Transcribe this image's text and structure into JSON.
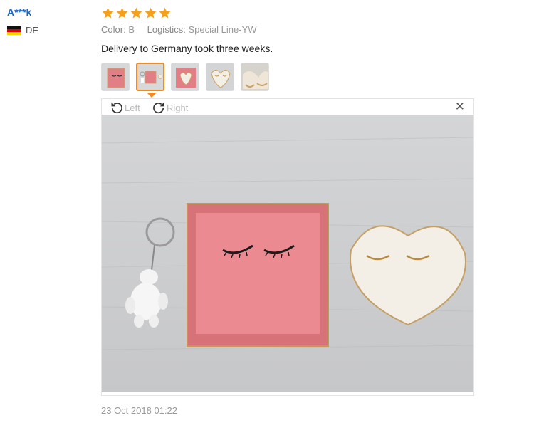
{
  "reviewer": {
    "name": "A***k",
    "country_code": "DE",
    "flag_icon": "germany-flag-icon"
  },
  "rating": {
    "stars": 5,
    "max": 5,
    "color": "#f5a01a"
  },
  "attributes": {
    "color_label": "Color:",
    "color_value": "B",
    "logistics_label": "Logistics:",
    "logistics_value": "Special Line-YW"
  },
  "comment": "Delivery to Germany took three weeks.",
  "thumbnails": {
    "count": 5,
    "selected_index": 1
  },
  "viewer": {
    "rotate_left_label": "Left",
    "rotate_right_label": "Right",
    "close_icon": "close-icon"
  },
  "date": "23 Oct 2018 01:22",
  "colors": {
    "accent": "#f08a24",
    "name_link": "#1a66c4",
    "dish_pink": "#e98088"
  }
}
